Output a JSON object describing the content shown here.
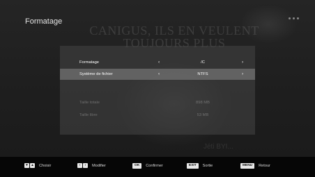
{
  "background": {
    "headline_line1": "CANIGUS, ILS EN VEULENT",
    "headline_line2": "TOUJOURS PLUS",
    "caption_text": "Jéti BYI..."
  },
  "page": {
    "title": "Formatage"
  },
  "menu": {
    "rows": [
      {
        "label": "Formatage",
        "value": "/C",
        "left_arrow": "‹",
        "right_arrow": "›"
      },
      {
        "label": "Système de fichier",
        "value": "NTFS",
        "left_arrow": "‹",
        "right_arrow": "›"
      },
      {
        "label": "Taille totale",
        "value": "898 MB"
      },
      {
        "label": "Taille libre",
        "value": "53 MB"
      }
    ]
  },
  "footer": {
    "hints": [
      {
        "keys": [
          "▾",
          "▴"
        ],
        "label": "Choisir"
      },
      {
        "keys": [
          "‹",
          "›"
        ],
        "label": "Modifier"
      },
      {
        "keys": [
          "OK"
        ],
        "label": "Confirmer"
      },
      {
        "keys": [
          "EXIT"
        ],
        "label": "Sortie"
      },
      {
        "keys": [
          "MENU"
        ],
        "label": "Retour"
      }
    ]
  },
  "colors": {
    "panel": "#464646",
    "selected_row": "#6e6e6e",
    "footer": "#060606",
    "key": "#e8e8e8"
  }
}
